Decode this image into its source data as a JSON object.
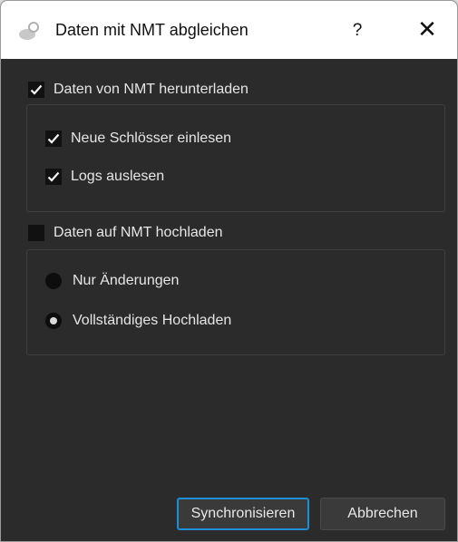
{
  "window": {
    "title": "Daten mit NMT abgleichen",
    "help_label": "?",
    "close_label": "✕"
  },
  "download": {
    "label": "Daten von NMT herunterladen",
    "checked": true,
    "options": [
      {
        "label": "Neue Schlösser einlesen",
        "checked": true
      },
      {
        "label": "Logs auslesen",
        "checked": true
      }
    ]
  },
  "upload": {
    "label": "Daten auf NMT hochladen",
    "checked": false,
    "options": [
      {
        "label": "Nur Änderungen",
        "selected": false
      },
      {
        "label": "Vollständiges Hochladen",
        "selected": true
      }
    ]
  },
  "buttons": {
    "sync_label": "Synchronisieren",
    "cancel_label": "Abbrechen"
  },
  "colors": {
    "background": "#2b2b2b",
    "titlebar": "#ffffff",
    "accent": "#1e8ed6"
  }
}
